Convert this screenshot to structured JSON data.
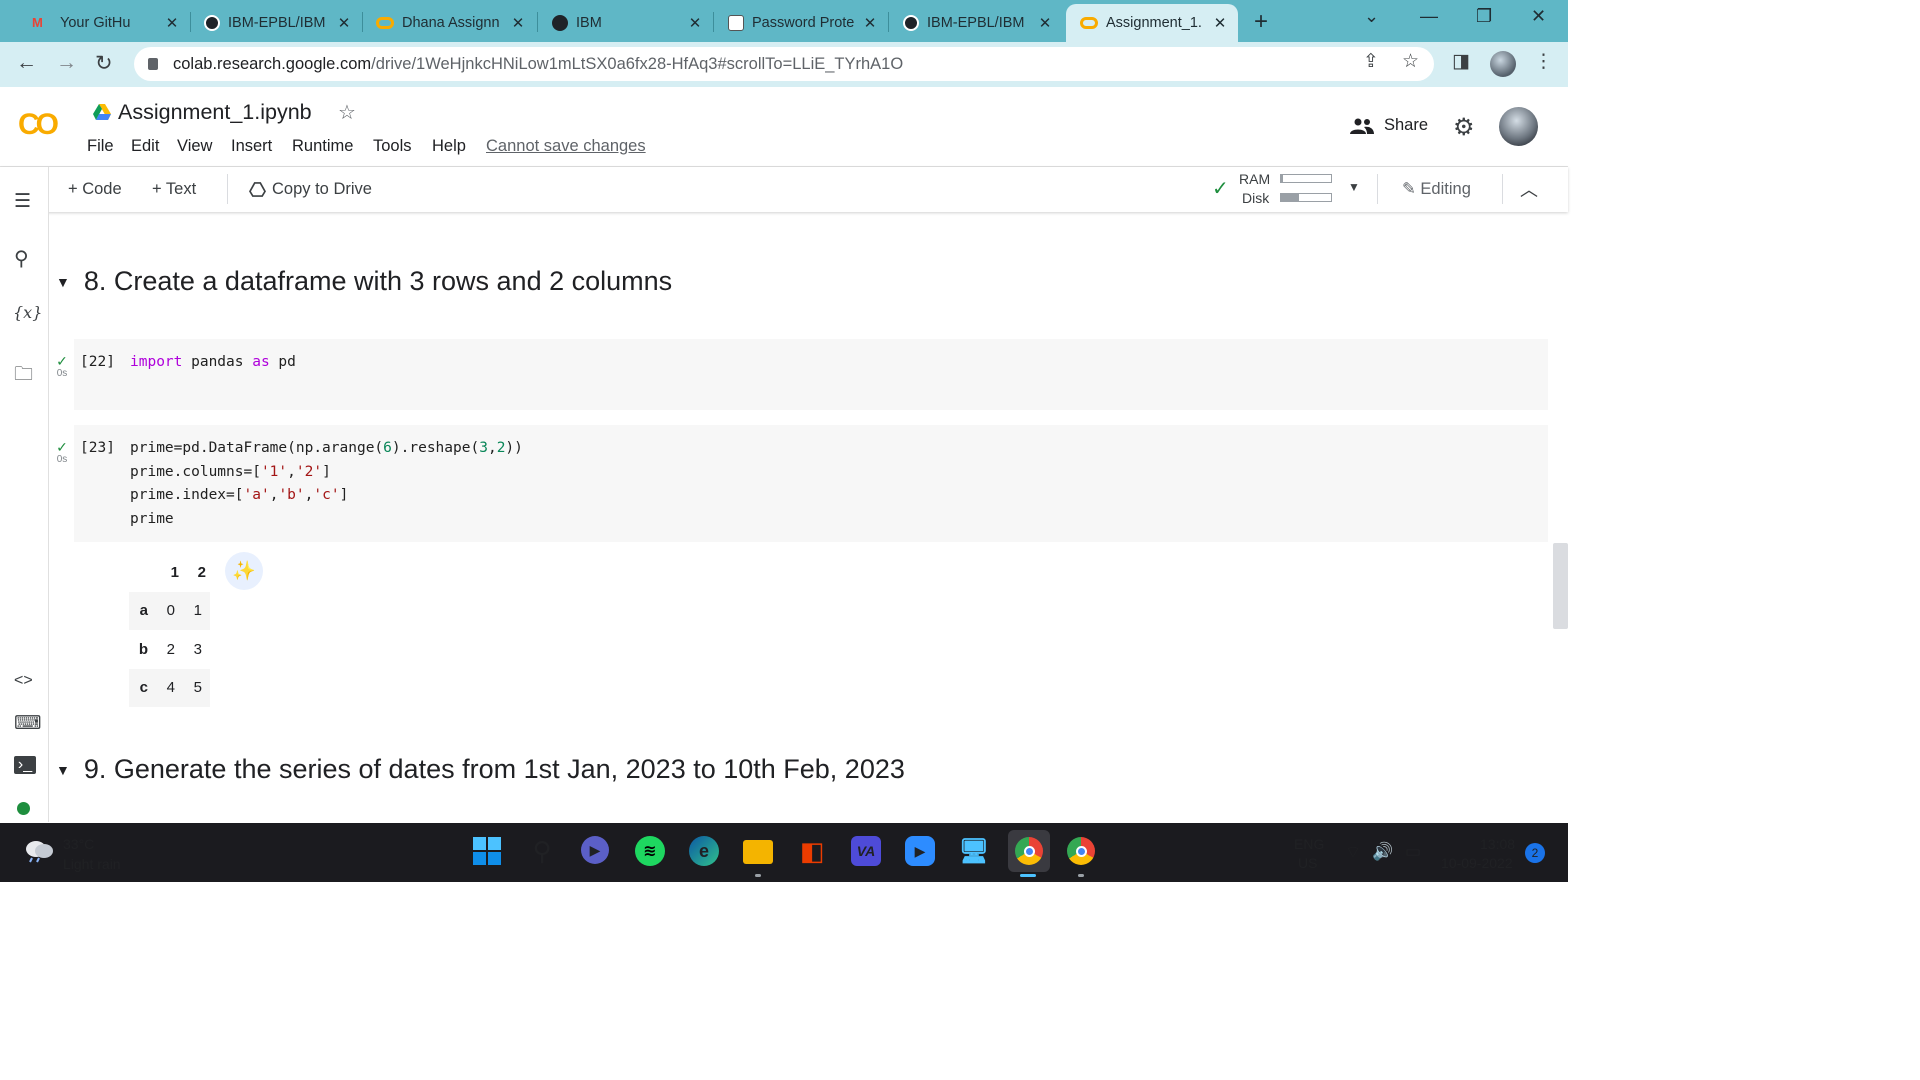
{
  "browser": {
    "tabs": [
      {
        "title": "Your GitHu",
        "icon": "gmail-github-icon"
      },
      {
        "title": "IBM-EPBL/IBM",
        "icon": "github-icon"
      },
      {
        "title": "Dhana Assignn",
        "icon": "colab-icon"
      },
      {
        "title": "IBM",
        "icon": "globe-icon"
      },
      {
        "title": "Password Prote",
        "icon": "password-icon"
      },
      {
        "title": "IBM-EPBL/IBM",
        "icon": "github-icon"
      },
      {
        "title": "Assignment_1.",
        "icon": "colab-icon"
      }
    ],
    "url_host": "colab.research.google.com",
    "url_path": "/drive/1WeHjnkcHNiLow1mLtSX0a6fx28-HfAq3#scrollTo=LLiE_TYrhA1O"
  },
  "colab": {
    "notebook_title": "Assignment_1.ipynb",
    "menu": [
      "File",
      "Edit",
      "View",
      "Insert",
      "Runtime",
      "Tools",
      "Help"
    ],
    "cannot_save": "Cannot save changes",
    "share_label": "Share",
    "toolbar": {
      "code_label": "+ Code",
      "text_label": "+ Text",
      "copy_drive_label": "Copy to Drive",
      "ram_label": "RAM",
      "disk_label": "Disk",
      "ram_usage": 0.03,
      "disk_usage": 0.35,
      "editing_label": "Editing"
    }
  },
  "notebook": {
    "heading8": "8. Create a dataframe with 3 rows and 2 columns",
    "heading9": "9. Generate the series of dates from 1st Jan, 2023 to 10th Feb, 2023",
    "cells": [
      {
        "exec": "[22]",
        "time": "0s"
      },
      {
        "exec": "[23]",
        "time": "0s"
      }
    ],
    "output": {
      "columns": [
        "1",
        "2"
      ],
      "rows": [
        {
          "index": "a",
          "values": [
            "0",
            "1"
          ]
        },
        {
          "index": "b",
          "values": [
            "2",
            "3"
          ]
        },
        {
          "index": "c",
          "values": [
            "4",
            "5"
          ]
        }
      ]
    }
  },
  "taskbar": {
    "temperature": "33°C",
    "condition": "Light rain",
    "lang1": "ENG",
    "lang2": "US",
    "time": "13:08",
    "date": "10-09-2022",
    "notifications": "2"
  },
  "colors": {
    "tabstrip": "#5fb7c6",
    "address_bar": "#d6eef3",
    "colab_orange": "#f9ab00",
    "keyword": "#af00db",
    "string": "#a31515",
    "number": "#098658"
  }
}
